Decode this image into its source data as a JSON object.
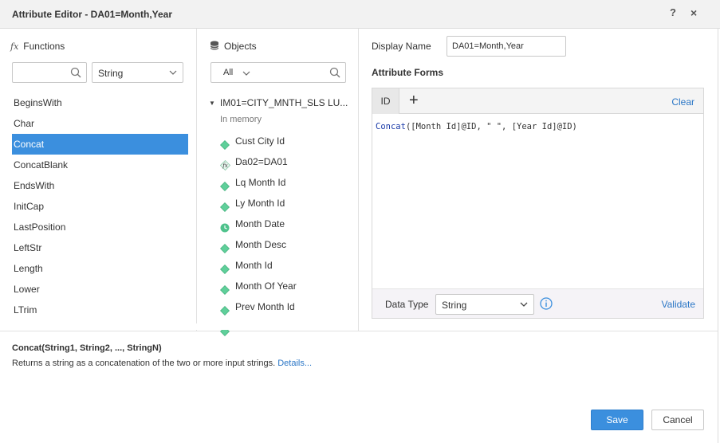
{
  "window": {
    "title": "Attribute Editor - DA01=Month,Year",
    "help_label": "?",
    "close_label": "×"
  },
  "functions": {
    "header": "Functions",
    "header_icon": "fx-icon",
    "search_placeholder": "",
    "category_selected": "String",
    "items": [
      {
        "label": "BeginsWith"
      },
      {
        "label": "Char"
      },
      {
        "label": "Concat",
        "selected": true
      },
      {
        "label": "ConcatBlank"
      },
      {
        "label": "EndsWith"
      },
      {
        "label": "InitCap"
      },
      {
        "label": "LastPosition"
      },
      {
        "label": "LeftStr"
      },
      {
        "label": "Length"
      },
      {
        "label": "Lower"
      },
      {
        "label": "LTrim"
      }
    ]
  },
  "objects": {
    "header": "Objects",
    "header_icon": "database-icon",
    "filter_selected": "All",
    "tree_root": "IM01=CITY_MNTH_SLS LU...",
    "in_memory_label": "In memory",
    "items": [
      {
        "label": "Cust City Id",
        "icon": "attribute-diamond-icon"
      },
      {
        "label": "Da02=DA01",
        "icon": "derived-fx-icon"
      },
      {
        "label": "Lq Month Id",
        "icon": "attribute-diamond-icon"
      },
      {
        "label": "Ly Month Id",
        "icon": "attribute-diamond-icon"
      },
      {
        "label": "Month Date",
        "icon": "clock-icon"
      },
      {
        "label": "Month Desc",
        "icon": "attribute-diamond-icon"
      },
      {
        "label": "Month Id",
        "icon": "attribute-diamond-icon"
      },
      {
        "label": "Month Of Year",
        "icon": "attribute-diamond-icon"
      },
      {
        "label": "Prev Month Id",
        "icon": "attribute-diamond-icon"
      }
    ]
  },
  "editor": {
    "display_name_label": "Display Name",
    "display_name_value": "DA01=Month,Year",
    "attribute_forms_label": "Attribute Forms",
    "tab_label": "ID",
    "add_label": "+",
    "clear_label": "Clear",
    "expression_function": "Concat",
    "expression_args": "([Month Id]@ID, \" \", [Year Id]@ID)",
    "data_type_label": "Data Type",
    "data_type_value": "String",
    "validate_label": "Validate"
  },
  "description": {
    "signature": "Concat(String1, String2, ..., StringN)",
    "text": "Returns a string as a concatenation of the two or more input strings.",
    "details_link": "Details..."
  },
  "buttons": {
    "save": "Save",
    "cancel": "Cancel"
  },
  "colors": {
    "accent": "#3b8fde",
    "link": "#2a76c6",
    "attribute_icon": "#5fcf9a"
  }
}
